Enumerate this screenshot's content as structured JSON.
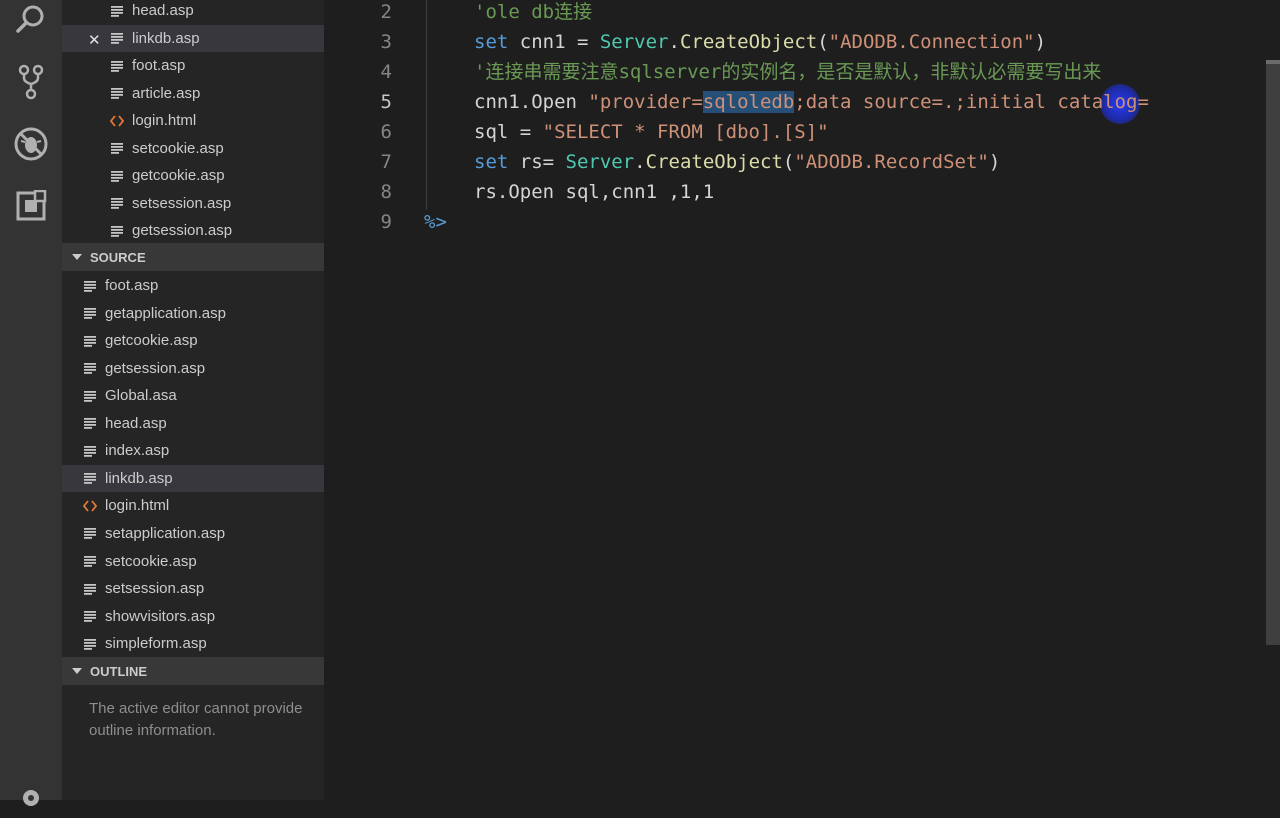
{
  "explorer": {
    "open_editors": [
      {
        "name": "head.asp",
        "type": "asp"
      },
      {
        "name": "linkdb.asp",
        "type": "asp",
        "selected": true,
        "close_icon": "✕"
      },
      {
        "name": "foot.asp",
        "type": "asp"
      },
      {
        "name": "article.asp",
        "type": "asp"
      },
      {
        "name": "login.html",
        "type": "html"
      },
      {
        "name": "setcookie.asp",
        "type": "asp"
      },
      {
        "name": "getcookie.asp",
        "type": "asp"
      },
      {
        "name": "setsession.asp",
        "type": "asp"
      },
      {
        "name": "getsession.asp",
        "type": "asp"
      }
    ],
    "source_header": "SOURCE",
    "source_files": [
      {
        "name": "foot.asp",
        "type": "asp"
      },
      {
        "name": "getapplication.asp",
        "type": "asp"
      },
      {
        "name": "getcookie.asp",
        "type": "asp"
      },
      {
        "name": "getsession.asp",
        "type": "asp"
      },
      {
        "name": "Global.asa",
        "type": "asp"
      },
      {
        "name": "head.asp",
        "type": "asp"
      },
      {
        "name": "index.asp",
        "type": "asp"
      },
      {
        "name": "linkdb.asp",
        "type": "asp",
        "selected": true
      },
      {
        "name": "login.html",
        "type": "html"
      },
      {
        "name": "setapplication.asp",
        "type": "asp"
      },
      {
        "name": "setcookie.asp",
        "type": "asp"
      },
      {
        "name": "setsession.asp",
        "type": "asp"
      },
      {
        "name": "showvisitors.asp",
        "type": "asp"
      },
      {
        "name": "simpleform.asp",
        "type": "asp"
      }
    ],
    "outline_header": "OUTLINE",
    "outline_message": "The active editor cannot provide outline information."
  },
  "activity_bar": {
    "icons": [
      "search-icon",
      "source-control-icon",
      "debug-icon",
      "extensions-icon",
      "settings-gear-icon"
    ]
  },
  "editor": {
    "active_line": 5,
    "lines": [
      {
        "num": "2",
        "tokens": [
          {
            "t": "'ole db连接",
            "c": "comment"
          }
        ]
      },
      {
        "num": "3",
        "tokens": [
          {
            "t": "set",
            "c": "kw"
          },
          {
            "t": " cnn1 = ",
            "c": "plain"
          },
          {
            "t": "Server",
            "c": "type"
          },
          {
            "t": ".",
            "c": "plain"
          },
          {
            "t": "CreateObject",
            "c": "fn"
          },
          {
            "t": "(",
            "c": "plain"
          },
          {
            "t": "\"ADODB.Connection\"",
            "c": "str"
          },
          {
            "t": ")",
            "c": "plain"
          }
        ]
      },
      {
        "num": "4",
        "tokens": [
          {
            "t": "'连接串需要注意sqlserver的实例名，是否是默认，非默认必需要写出来",
            "c": "comment"
          }
        ]
      },
      {
        "num": "5",
        "tokens": [
          {
            "t": "cnn1.Open ",
            "c": "plain"
          },
          {
            "t": "\"provider=",
            "c": "str"
          },
          {
            "t": "sqloledb",
            "c": "sel"
          },
          {
            "t": ";data source=.;initial catalog=",
            "c": "str"
          }
        ]
      },
      {
        "num": "6",
        "tokens": [
          {
            "t": "sql = ",
            "c": "plain"
          },
          {
            "t": "\"SELECT * FROM [dbo].[S]\"",
            "c": "str"
          }
        ]
      },
      {
        "num": "7",
        "tokens": [
          {
            "t": "set",
            "c": "kw"
          },
          {
            "t": " rs= ",
            "c": "plain"
          },
          {
            "t": "Server",
            "c": "type"
          },
          {
            "t": ".",
            "c": "plain"
          },
          {
            "t": "CreateObject",
            "c": "fn"
          },
          {
            "t": "(",
            "c": "plain"
          },
          {
            "t": "\"ADODB.RecordSet\"",
            "c": "str"
          },
          {
            "t": ")",
            "c": "plain"
          }
        ]
      },
      {
        "num": "8",
        "tokens": [
          {
            "t": "rs.Open sql,cnn1 ,1,1",
            "c": "plain"
          }
        ]
      },
      {
        "num": "9",
        "tokens": [
          {
            "t": "%>",
            "c": "delim"
          }
        ]
      }
    ]
  },
  "colors": {
    "activity_bar": "#333333",
    "sidebar": "#252526",
    "editor": "#1e1e1e",
    "selection": "#264f78",
    "comment": "#6a9955",
    "keyword": "#569cd6",
    "string": "#ce9178",
    "type": "#4ec9b0",
    "function": "#dcdcaa",
    "html_icon": "#e37933"
  }
}
